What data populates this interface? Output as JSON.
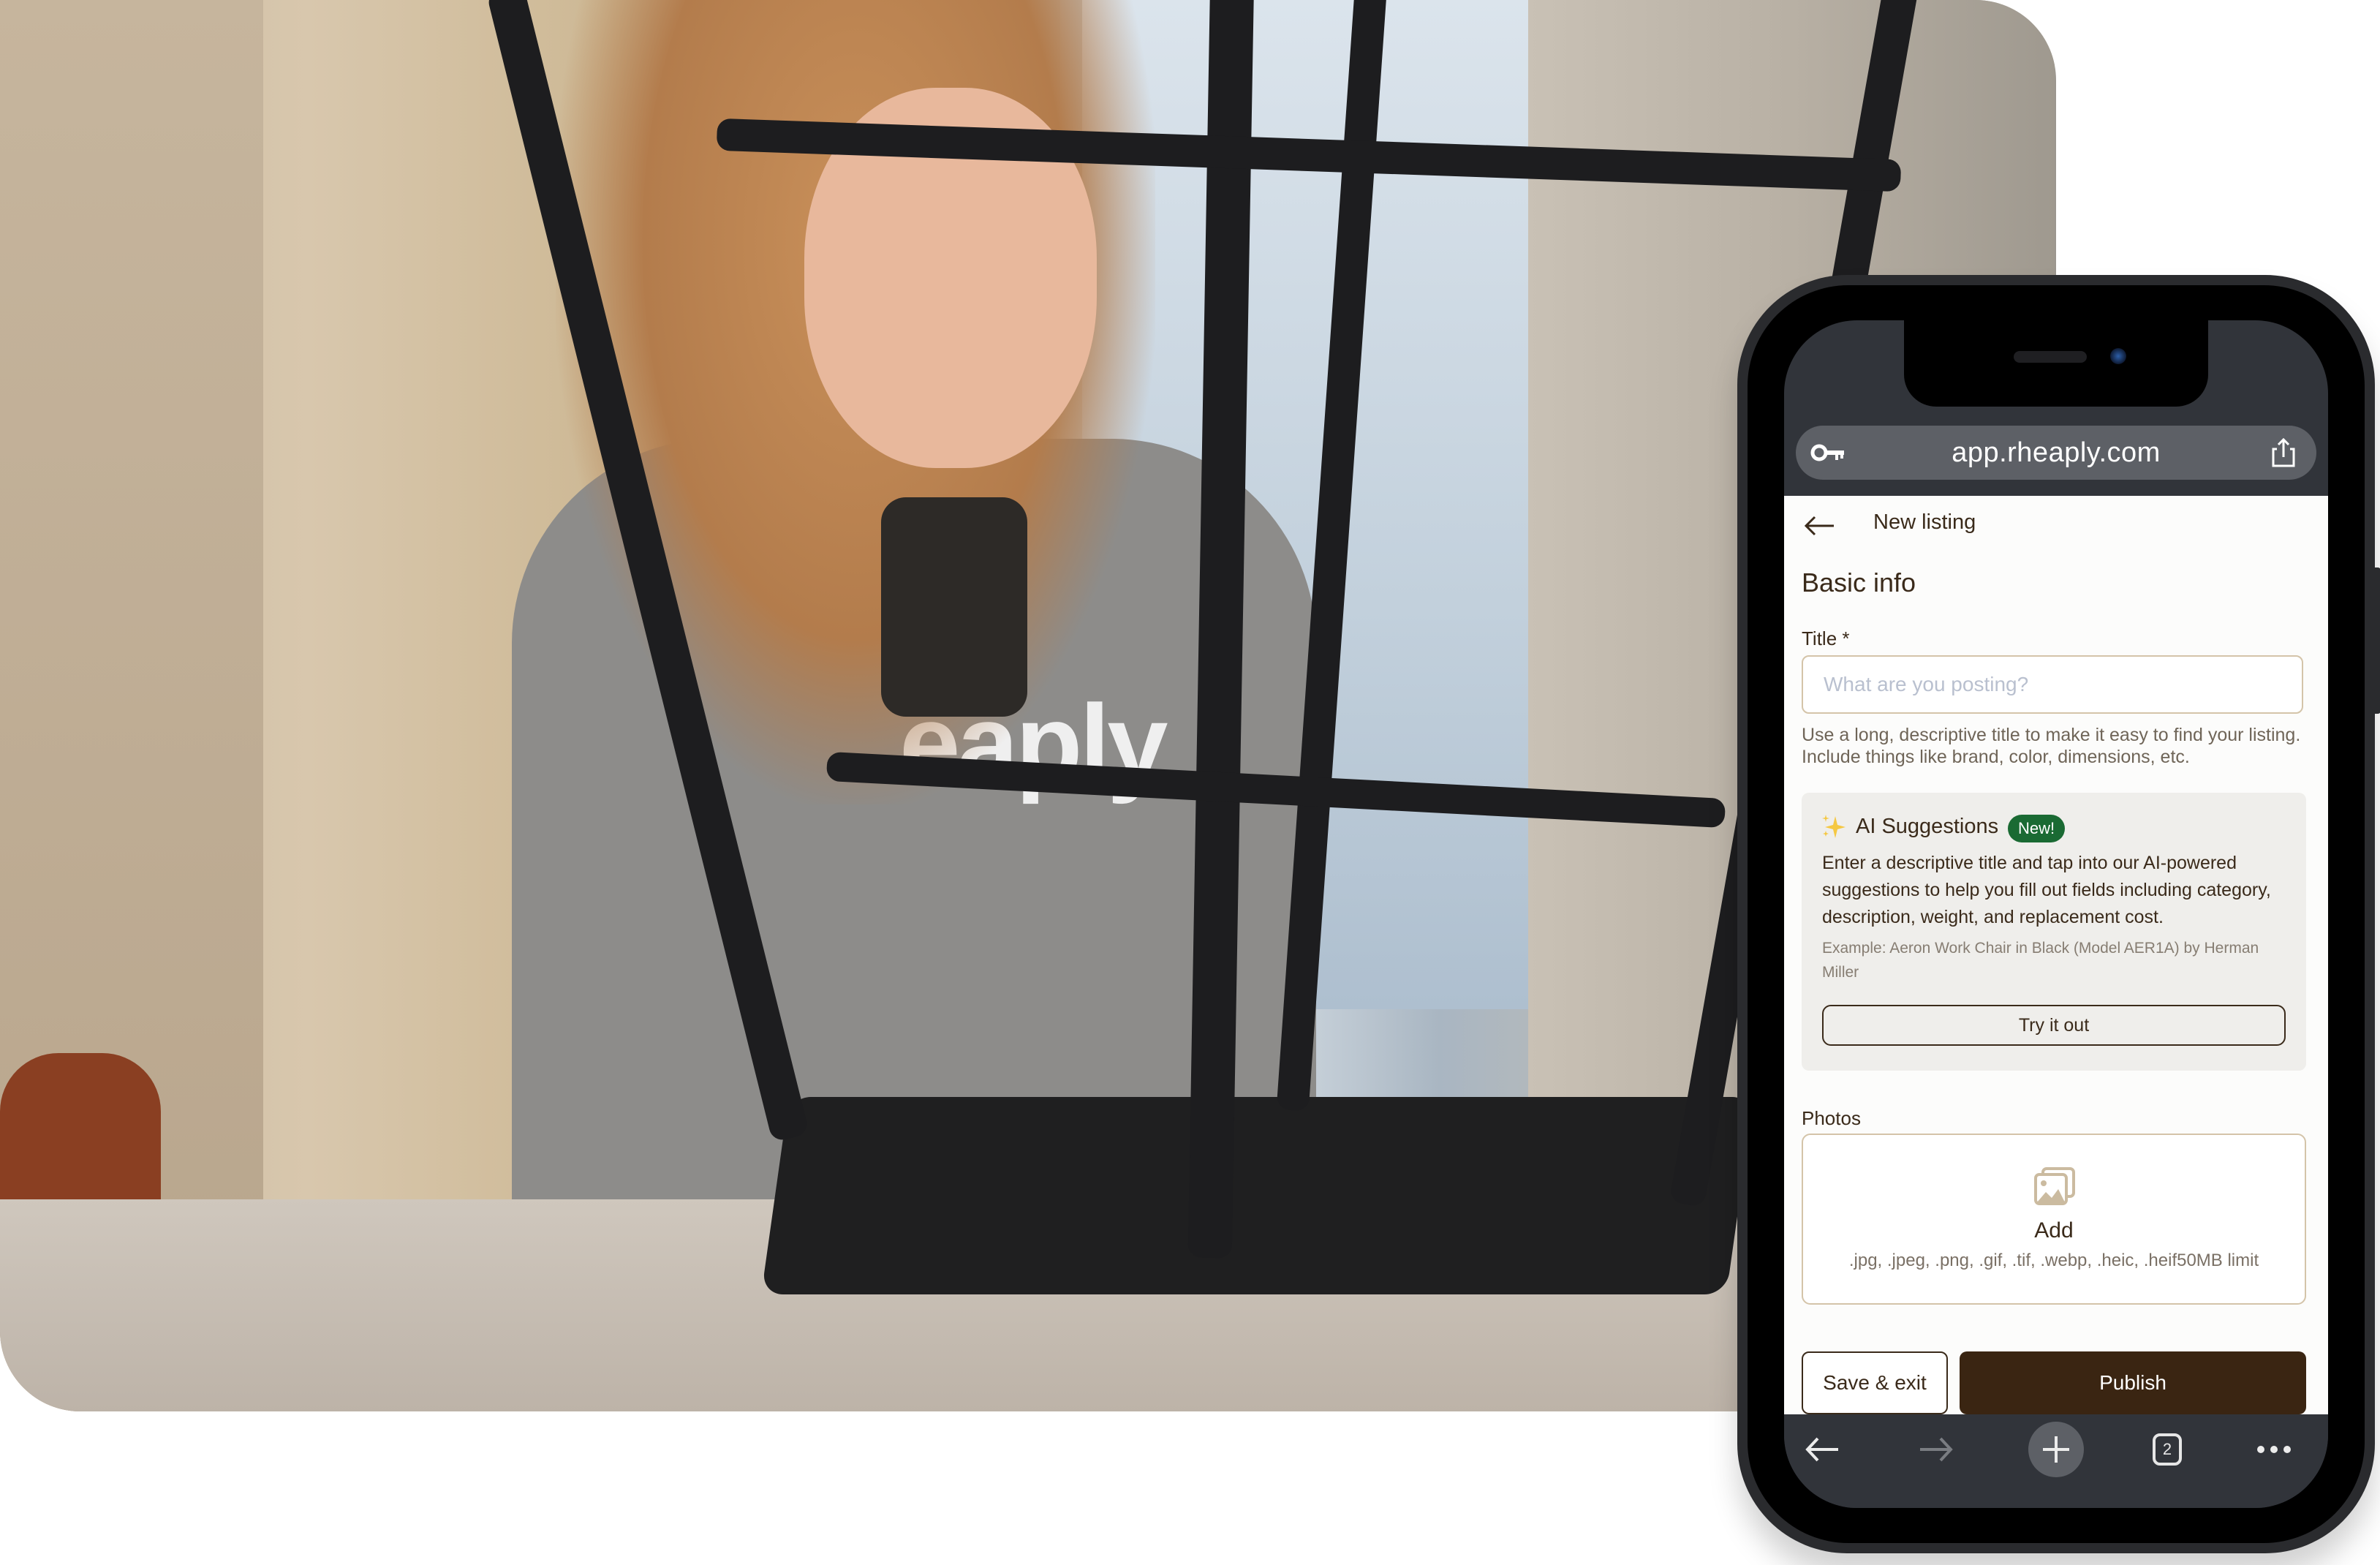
{
  "photo": {
    "description": "Woman in grey shirt photographing an upside-down black stool with her phone",
    "shirt_text": "eaply"
  },
  "browser": {
    "url": "app.rheaply.com",
    "icons": {
      "left": "key-icon",
      "right": "share-icon"
    },
    "toolbar": {
      "back": "back-arrow-icon",
      "forward": "forward-arrow-icon",
      "new_tab": "plus-icon",
      "tab_count": "2",
      "more": "more-dots-icon"
    }
  },
  "app": {
    "header": {
      "back_icon": "back-arrow-icon",
      "title": "New listing"
    },
    "section_title": "Basic info",
    "title_field": {
      "label": "Title *",
      "value": "",
      "placeholder": "What are you posting?",
      "helper": "Use a long, descriptive title to make it easy to find your listing. Include things like brand, color, dimensions, etc."
    },
    "ai_card": {
      "icon": "sparkles-icon",
      "title": "AI Suggestions",
      "badge": "New!",
      "description": "Enter a descriptive title and tap into our AI-powered suggestions to help you fill out fields including category, description, weight, and replacement cost.",
      "example": "Example: Aeron Work Chair in Black (Model AER1A) by Herman Miller",
      "button": "Try it out"
    },
    "photos": {
      "label": "Photos",
      "icon": "image-gallery-icon",
      "add_label": "Add",
      "formats": ".jpg, .jpeg, .png, .gif, .tif, .webp, .heic, .heif50MB limit"
    },
    "actions": {
      "save": "Save & exit",
      "publish": "Publish"
    }
  },
  "colors": {
    "primary_dark": "#3a2512",
    "text": "#3a2a1a",
    "badge_green": "#1a6a33",
    "input_border": "#d4c4a9",
    "card_bg": "#efeeeb",
    "browser_chrome": "#31343a",
    "url_pill": "#5d6066"
  }
}
